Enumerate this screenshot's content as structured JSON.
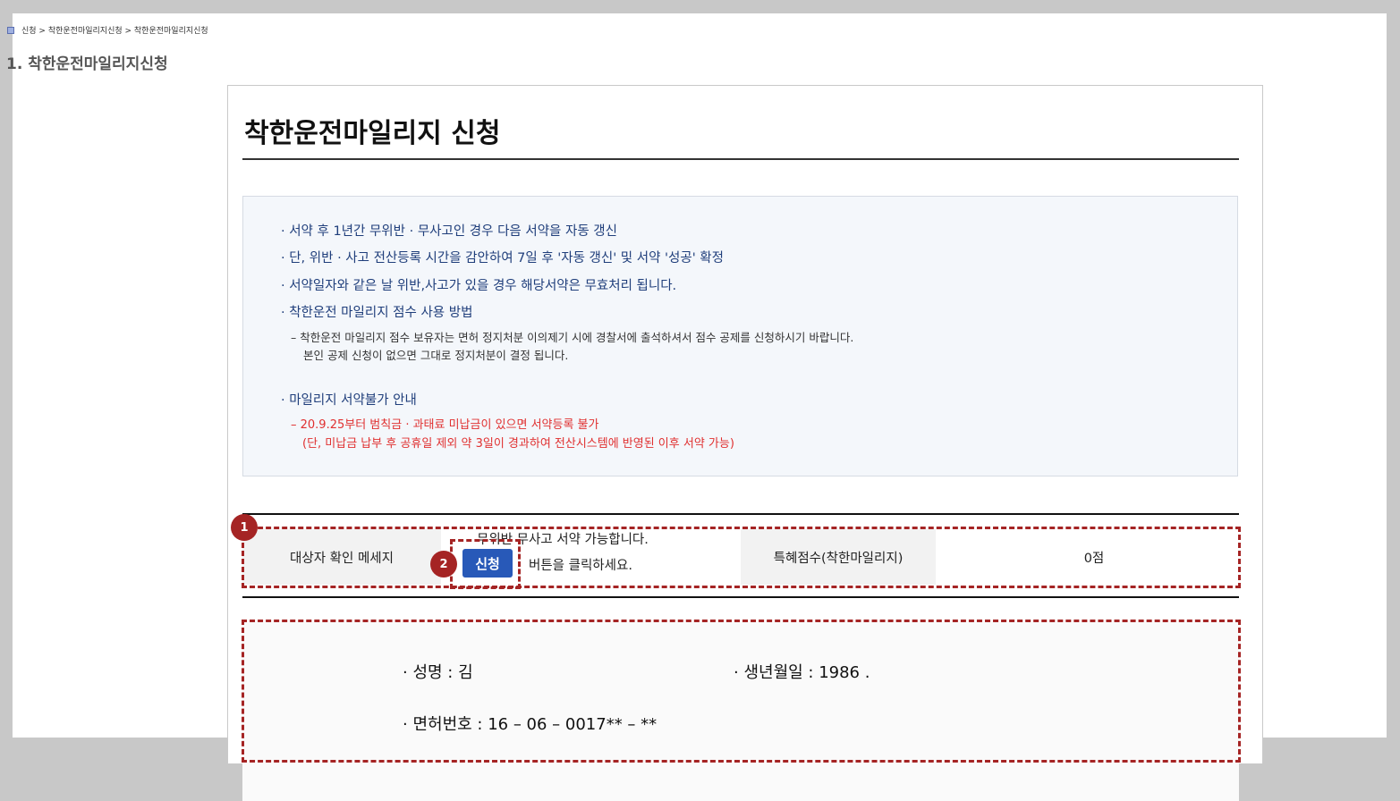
{
  "breadcrumb": {
    "text": "신청 > 착한운전마일리지신청 > 착한운전마일리지신청"
  },
  "section_title": "1. 착한운전마일리지신청",
  "doc": {
    "title": "착한운전마일리지 신청",
    "notice": {
      "item1": "· 서약 후 1년간 무위반 · 무사고인 경우 다음 서약을 자동 갱신",
      "item2": "· 단, 위반 · 사고 전산등록 시간을 감안하여 7일 후 '자동 갱신' 및 서약 '성공' 확정",
      "item3": "· 서약일자와 같은 날 위반,사고가 있을 경우 해당서약은 무효처리 됩니다.",
      "item4": "· 착한운전 마일리지 점수 사용 방법",
      "item4_sub1": "– 착한운전 마일리지 점수 보유자는 면허 정지처분 이의제기 시에 경찰서에 출석하셔서 점수 공제를 신청하시기 바랍니다.",
      "item4_sub2": "본인 공제 신청이 없으면 그대로 정지처분이 결정 됩니다.",
      "item5": "· 마일리지 서약불가 안내",
      "item5_red1": "– 20.9.25부터 범칙금 · 과태료 미납금이 있으면 서약등록 불가",
      "item5_red2": "(단, 미납금 납부 후 공휴일 제외 약 3일이 경과하여 전산시스템에 반영된 이후 서약 가능)"
    },
    "target_row": {
      "label": "대상자 확인 메세지",
      "message_line1": "무위반 무사고 서약 가능합니다.",
      "message_line2": "버튼을 클릭하세요.",
      "apply_button": "신청",
      "benefit_label": "특혜점수(착한마일리지)",
      "benefit_value": "0점"
    },
    "info": {
      "name": "· 성명 : 김",
      "birth": "· 생년월일 : 1986 .",
      "license": "· 면허번호 : 16 – 06 – 0017** – **"
    }
  },
  "annotations": {
    "badge1": "1",
    "badge2": "2"
  },
  "colors": {
    "annotation": "#a52424",
    "button": "#2859b8",
    "notice_text": "#1f3e7b",
    "warning": "#e03030"
  }
}
